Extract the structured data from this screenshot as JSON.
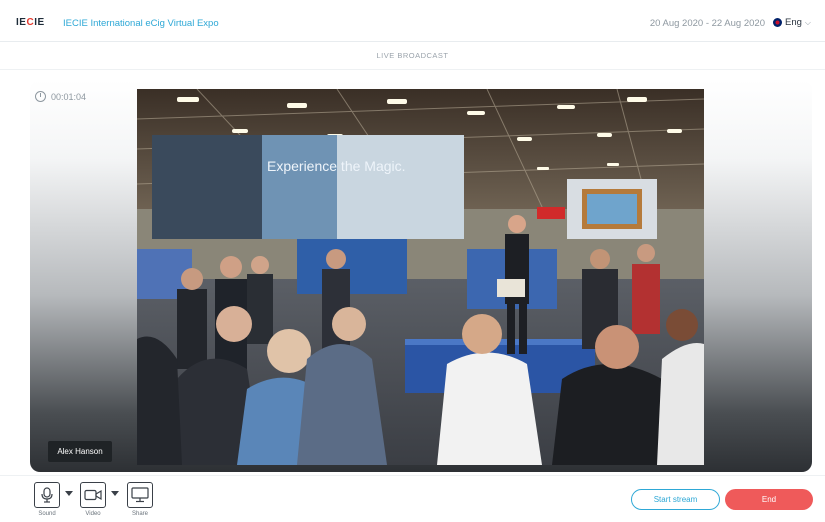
{
  "header": {
    "logo_text": "IECIE",
    "expo_title": "IECIE International eCig Virtual Expo",
    "date_range": "20 Aug 2020 - 22 Aug 2020",
    "language": "Eng"
  },
  "broadcast": {
    "section_title": "LIVE BROADCAST",
    "timer": "00:01:04",
    "presenter_name": "Alex Hanson",
    "banner_text": "Experience the Magic."
  },
  "controls": {
    "sound_label": "Sound",
    "video_label": "Video",
    "share_label": "Share",
    "start_stream_label": "Start stream",
    "end_label": "End"
  },
  "colors": {
    "accent": "#2ea8d6",
    "end_button": "#ef5a5a",
    "logo_accent": "#e63a2e"
  }
}
